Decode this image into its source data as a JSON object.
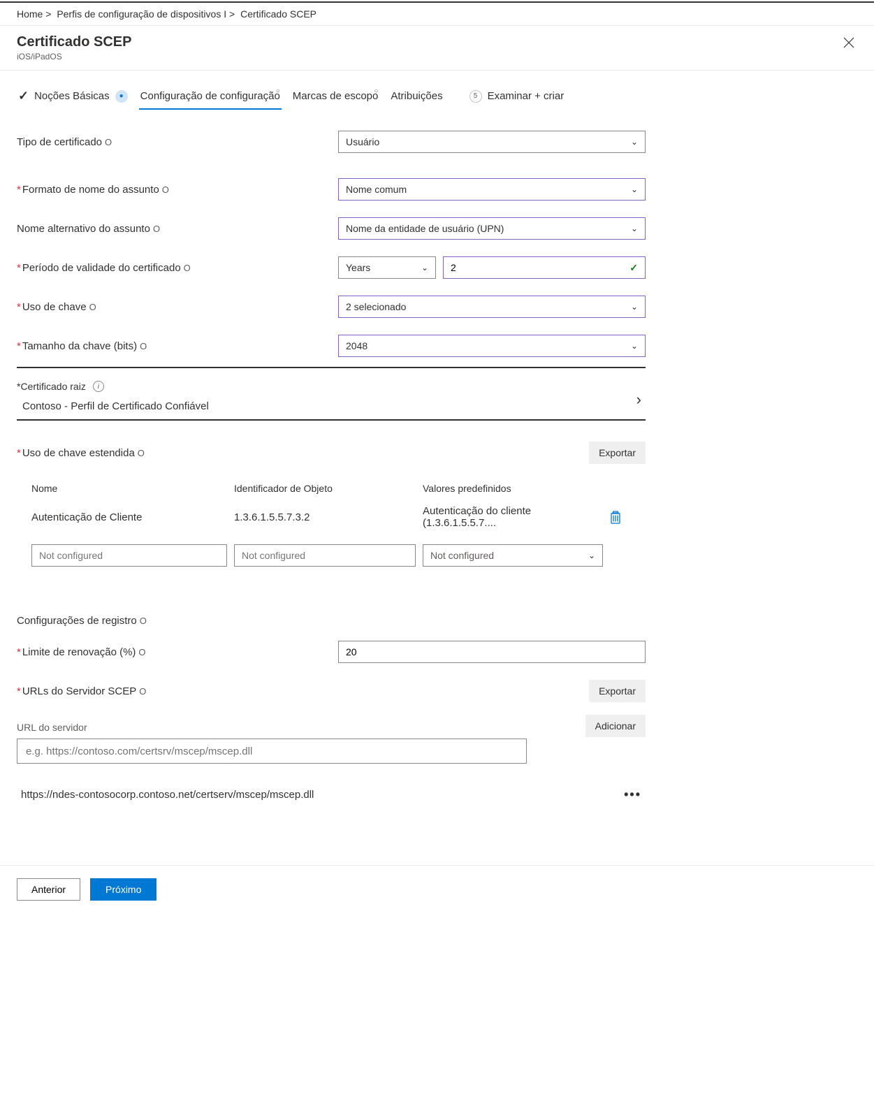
{
  "breadcrumb": {
    "item1": "Home >",
    "item2": "Perfis de configuração de dispositivos I >",
    "item3": "Certificado SCEP"
  },
  "header": {
    "title": "Certificado SCEP",
    "subtitle": "iOS/iPadOS"
  },
  "wizard": {
    "step1_label": "Noções Básicas",
    "step2_label": "Configuração de configuração",
    "step3_label": "Marcas de escopo",
    "step4_label": "Atribuições",
    "step5_badge": "5",
    "step5_label": "Examinar + criar"
  },
  "fields": {
    "cert_type_label": "Tipo de certificado",
    "cert_type_value": "Usuário",
    "subject_format_label": "Formato de nome do assunto",
    "subject_format_value": "Nome comum",
    "san_label": "Nome alternativo do assunto",
    "san_value": "Nome da entidade de usuário (UPN)",
    "validity_label": "Período de validade do certificado",
    "validity_unit": "Years",
    "validity_value": "2",
    "key_usage_label": "Uso de chave",
    "key_usage_value": "2 selecionado",
    "key_size_label": "Tamanho da chave (bits)",
    "key_size_value": "2048",
    "root_cert_label": "*Certificado raiz",
    "root_cert_value": "Contoso - Perfil de Certificado Confiável",
    "eku_label": "Uso de chave estendida",
    "export_btn": "Exportar",
    "eku_col1": "Nome",
    "eku_col2": "Identificador de Objeto",
    "eku_col3": "Valores predefinidos",
    "eku_row_name": "Autenticação de Cliente",
    "eku_row_oid": "1.3.6.1.5.5.7.3.2",
    "eku_row_preset": "Autenticação do cliente (1.3.6.1.5.5.7....",
    "not_configured": "Not configured",
    "enroll_heading": "Configurações de registro",
    "renewal_label": "Limite de renovação (%)",
    "renewal_value": "20",
    "scep_urls_label": "URLs do Servidor SCEP",
    "add_btn": "Adicionar",
    "server_url_label": "URL do servidor",
    "server_url_placeholder": "e.g. https://contoso.com/certsrv/mscep/mscep.dll",
    "server_url_entry": "https://ndes-contosocorp.contoso.net/certserv/mscep/mscep.dll"
  },
  "footer": {
    "prev": "Anterior",
    "next": "Próximo"
  },
  "info_glyph": "O"
}
